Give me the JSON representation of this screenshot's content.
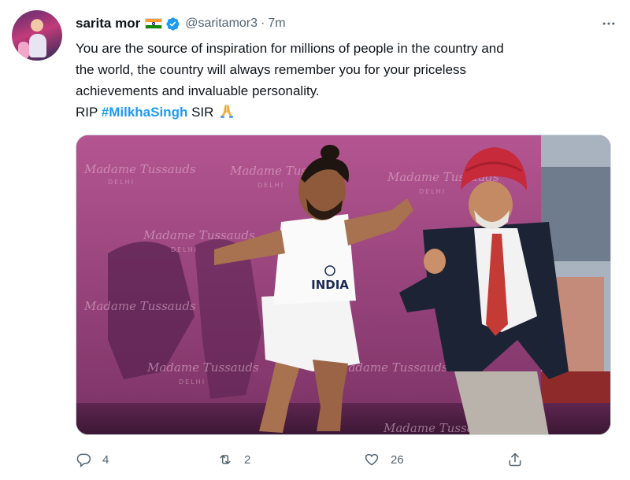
{
  "author": {
    "name": "sarita mor",
    "handle": "@saritamor3",
    "separator": "·",
    "time": "7m"
  },
  "icons": {
    "flag": "india-flag-icon",
    "verified": "verified-badge-icon",
    "more": "more-icon",
    "pray": "folded-hands-emoji",
    "reply": "reply-icon",
    "retweet": "retweet-icon",
    "like": "heart-icon",
    "share": "share-icon"
  },
  "colors": {
    "accent": "#1d9bf0",
    "muted": "#536471",
    "text": "#0f1419"
  },
  "tweet": {
    "line1": "You are the source of inspiration for millions of people in the country and",
    "line2": "the world, the country will always remember you for your priceless",
    "line3": "achievements and invaluable personality.",
    "rip_prefix": "RIP ",
    "hashtag": "#MilkhaSingh",
    "rip_suffix": " SIR "
  },
  "media": {
    "watermark": "Madame Tussauds",
    "watermark_sub": "DELHI",
    "jersey_text": "INDIA",
    "alt": "photo"
  },
  "actions": {
    "replies": "4",
    "retweets": "2",
    "likes": "26"
  }
}
